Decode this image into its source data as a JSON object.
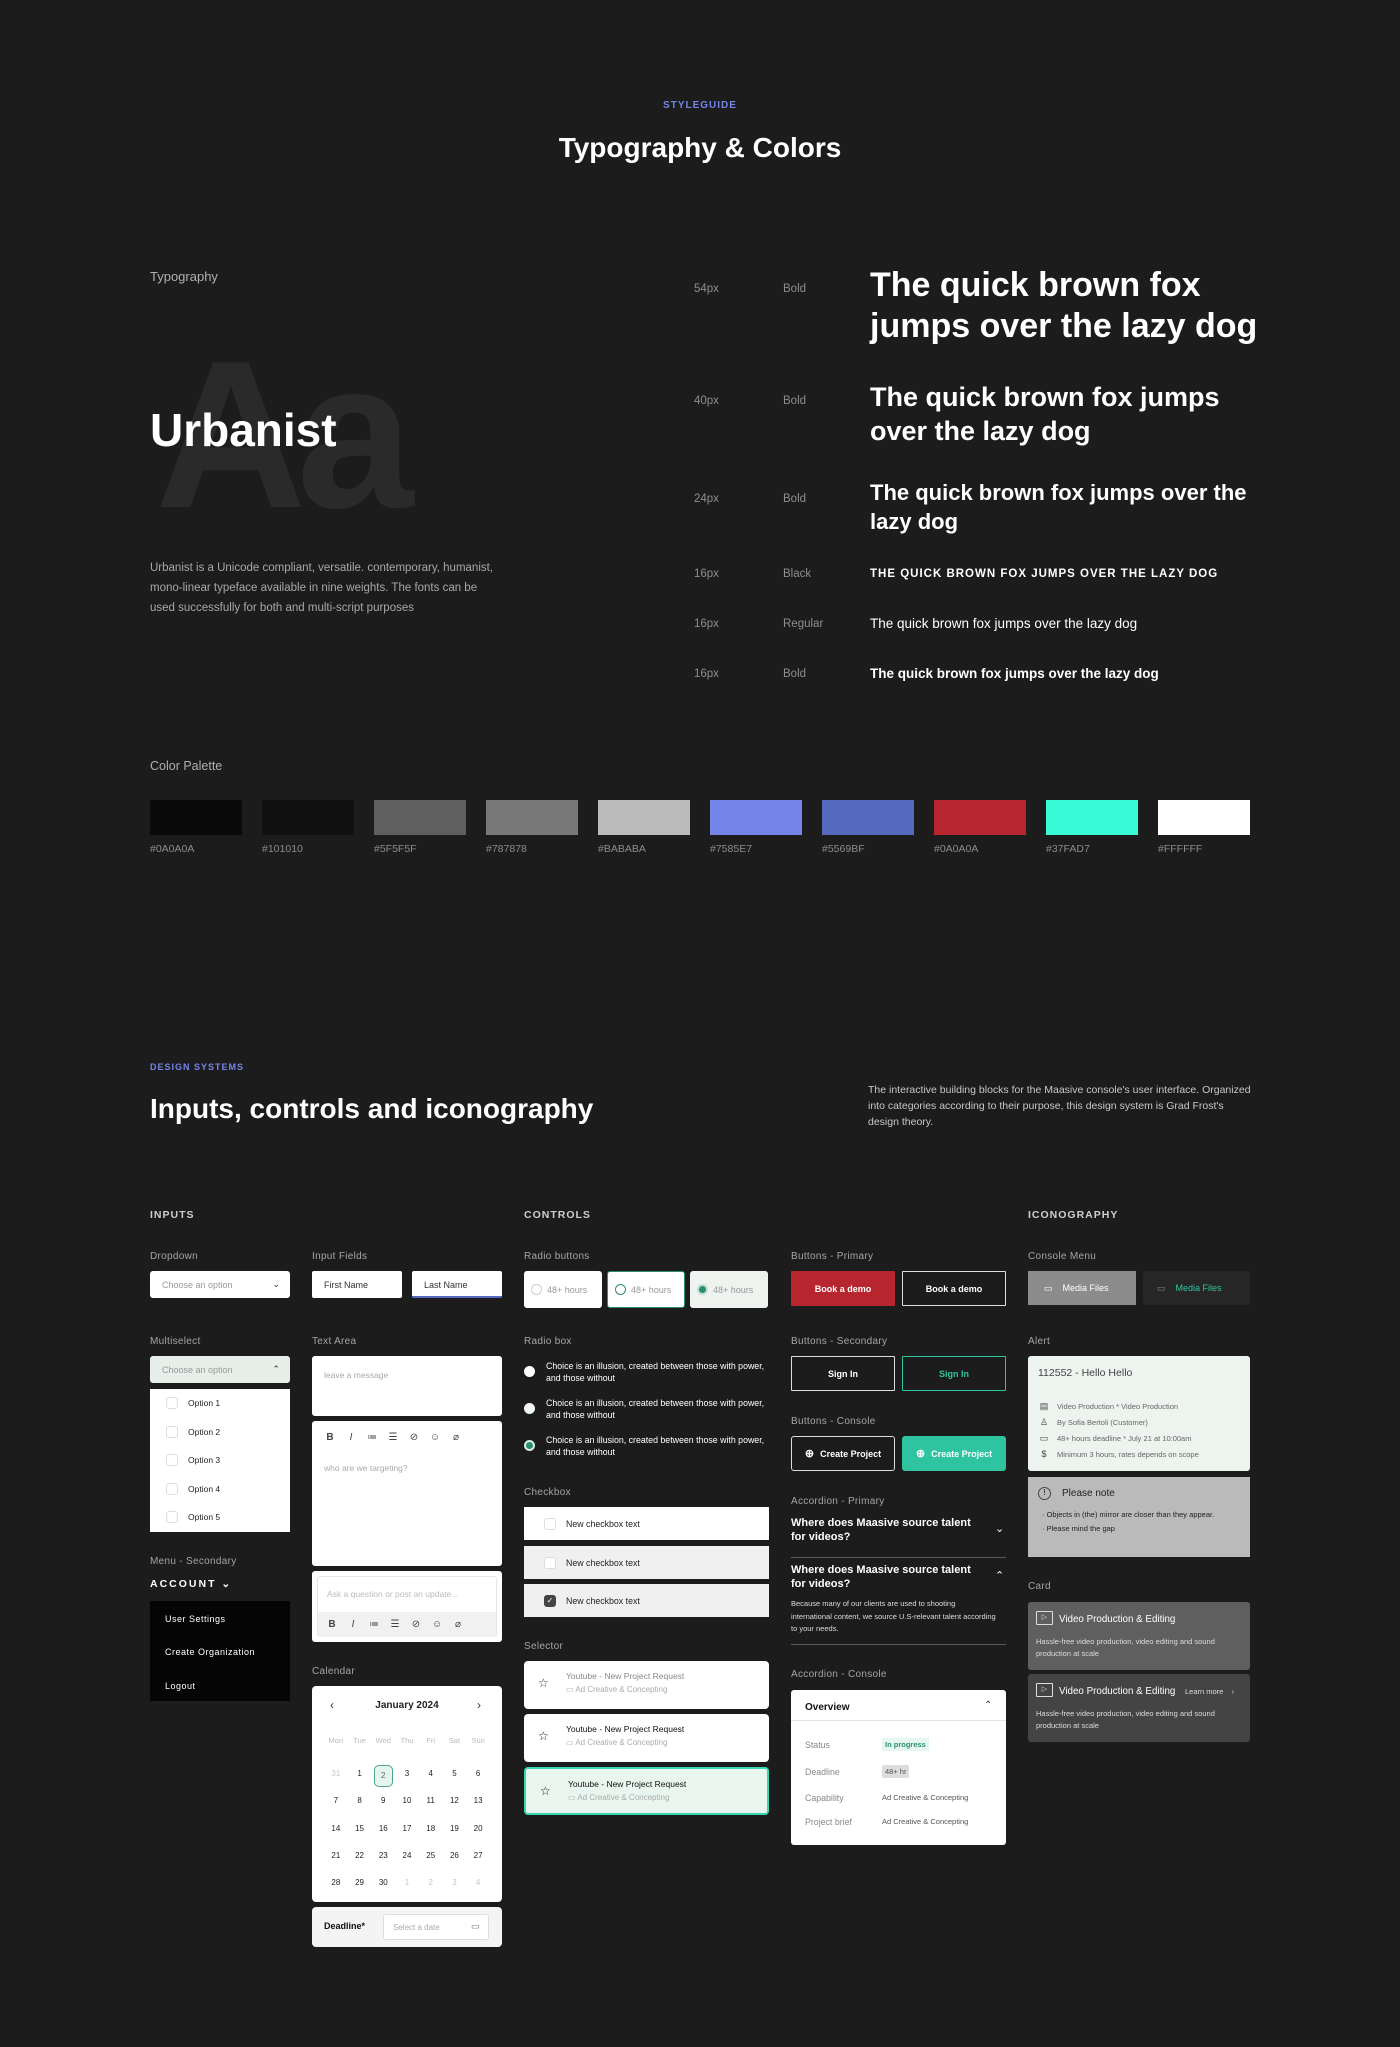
{
  "header": {
    "eyebrow": "STYLEGUIDE",
    "title": "Typography & Colors"
  },
  "typography": {
    "section_label": "Typography",
    "font_name": "Urbanist",
    "glyph_sample": "Aa",
    "description": "Urbanist is a Unicode compliant, versatile. contemporary, humanist, mono-linear typeface available in nine weights. The fonts can be used successfully for both and multi-script purposes",
    "samples": [
      {
        "size": "54px",
        "weight": "Bold",
        "text": "The quick brown fox jumps over the lazy dog"
      },
      {
        "size": "40px",
        "weight": "Bold",
        "text": "The quick brown fox jumps over the lazy dog"
      },
      {
        "size": "24px",
        "weight": "Bold",
        "text": "The quick brown fox jumps over the lazy dog"
      },
      {
        "size": "16px",
        "weight": "Black",
        "text": "THE QUICK BROWN FOX JUMPS OVER THE LAZY DOG"
      },
      {
        "size": "16px",
        "weight": "Regular",
        "text": "The quick brown fox jumps over the lazy dog"
      },
      {
        "size": "16px",
        "weight": "Bold",
        "text": "The quick brown fox jumps over the lazy dog"
      }
    ]
  },
  "palette": {
    "label": "Color Palette",
    "colors": [
      {
        "hex": "#0A0A0A",
        "label": "#0A0A0A"
      },
      {
        "hex": "#101010",
        "label": "#101010"
      },
      {
        "hex": "#5F5F5F",
        "label": "#5F5F5F"
      },
      {
        "hex": "#787878",
        "label": "#787878"
      },
      {
        "hex": "#BABABA",
        "label": "#BABABA"
      },
      {
        "hex": "#7585E7",
        "label": "#7585E7"
      },
      {
        "hex": "#5569BF",
        "label": "#5569BF"
      },
      {
        "hex": "#B7252F",
        "label": "#0A0A0A"
      },
      {
        "hex": "#37FAD7",
        "label": "#37FAD7"
      },
      {
        "hex": "#FFFFFF",
        "label": "#FFFFFF"
      }
    ]
  },
  "design_systems": {
    "eyebrow": "DESIGN SYSTEMS",
    "title": "Inputs, controls and iconography",
    "description": "The interactive building blocks for the Maasive console's user interface. Organized into categories according to their purpose, this design system is Grad Frost's design theory."
  },
  "inputs": {
    "heading": "INPUTS",
    "dropdown": {
      "label": "Dropdown",
      "placeholder": "Choose an option"
    },
    "input_fields": {
      "label": "Input Fields",
      "first_name": "First Name",
      "last_name": "Last Name"
    },
    "multiselect": {
      "label": "Multiselect",
      "placeholder": "Choose an option",
      "options": [
        "Option 1",
        "Option 2",
        "Option 3",
        "Option 4",
        "Option 5"
      ]
    },
    "text_area": {
      "label": "Text Area",
      "placeholder": "leave a message",
      "rich_placeholder": "who are we targeting?",
      "comment_placeholder": "Ask a question or post an update ..",
      "toolbar": [
        "B",
        "I",
        "≔",
        "☰",
        "🔗",
        "☺",
        "📎"
      ]
    },
    "menu_secondary": {
      "label": "Menu - Secondary",
      "trigger": "ACCOUNT",
      "items": [
        "User Settings",
        "Create Organization",
        "Logout"
      ]
    },
    "calendar": {
      "label": "Calendar",
      "month": "January 2024",
      "weekdays": [
        "Mon",
        "Tue",
        "Wed",
        "Thu",
        "Fri",
        "Sat",
        "Sun"
      ],
      "days": [
        {
          "d": "31",
          "muted": true
        },
        {
          "d": "1"
        },
        {
          "d": "2",
          "selected": true
        },
        {
          "d": "3"
        },
        {
          "d": "4"
        },
        {
          "d": "5"
        },
        {
          "d": "6"
        },
        {
          "d": "7"
        },
        {
          "d": "8"
        },
        {
          "d": "9"
        },
        {
          "d": "10"
        },
        {
          "d": "11"
        },
        {
          "d": "12"
        },
        {
          "d": "13"
        },
        {
          "d": "14"
        },
        {
          "d": "15"
        },
        {
          "d": "16"
        },
        {
          "d": "17"
        },
        {
          "d": "18"
        },
        {
          "d": "19"
        },
        {
          "d": "20"
        },
        {
          "d": "21"
        },
        {
          "d": "22"
        },
        {
          "d": "23"
        },
        {
          "d": "24"
        },
        {
          "d": "25"
        },
        {
          "d": "26"
        },
        {
          "d": "27"
        },
        {
          "d": "28"
        },
        {
          "d": "29"
        },
        {
          "d": "30"
        },
        {
          "d": "1",
          "muted": true
        },
        {
          "d": "2",
          "muted": true
        },
        {
          "d": "3",
          "muted": true
        },
        {
          "d": "4",
          "muted": true
        }
      ],
      "deadline_label": "Deadline*",
      "deadline_placeholder": "Select a date"
    }
  },
  "controls": {
    "heading": "CONTROLS",
    "radio_buttons": {
      "label": "Radio buttons",
      "option": "48+ hours"
    },
    "radio_box": {
      "label": "Radio box",
      "text": "Choice is an illusion, created between those with power, and those without"
    },
    "checkbox": {
      "label": "Checkbox",
      "text": "New checkbox text"
    },
    "selector": {
      "label": "Selector",
      "title": "Youtube - New Project Request",
      "subtitle": "Ad Creative & Concepting"
    },
    "buttons_primary": {
      "label": "Buttons - Primary",
      "text": "Book a demo"
    },
    "buttons_secondary": {
      "label": "Buttons - Secondary",
      "text": "Sign In"
    },
    "buttons_console": {
      "label": "Buttons - Console",
      "text": "Create Project"
    },
    "accordion_primary": {
      "label": "Accordion - Primary",
      "question": "Where does Maasive source talent for videos?",
      "answer": "Because many of our clients are used to shooting international content, we source U.S-relevant talent according to your needs."
    },
    "accordion_console": {
      "label": "Accordion - Console",
      "title": "Overview",
      "rows": [
        {
          "key": "Status",
          "value": "In progress"
        },
        {
          "key": "Deadline",
          "value": "48+ hr"
        },
        {
          "key": "Capability",
          "value": "Ad Creative & Concepting"
        },
        {
          "key": "Project brief",
          "value": "Ad Creative & Concepting"
        }
      ]
    }
  },
  "iconography": {
    "heading": "ICONOGRAPHY",
    "console_menu": {
      "label": "Console Menu",
      "item": "Media Files"
    },
    "alert": {
      "label": "Alert",
      "title": "112552 - Hello Hello",
      "lines": [
        "Video Production * Video Production",
        "By Sofia Bertoli (Customer)",
        "48+ hours deadline * July 21 at 10:00am",
        "Minimum 3 hours, rates depends on scope"
      ],
      "note_title": "Please note",
      "note_items": [
        "Objects in (the) mirror are closer than they appear.",
        "Please mind the gap"
      ]
    },
    "card": {
      "label": "Card",
      "title": "Video Production & Editing",
      "description": "Hassle-free video production, video editing and sound production at scale",
      "link": "Learn more"
    }
  },
  "colors": {
    "accent": "#7585E7",
    "green": "#2EC4A0",
    "red": "#B7252F"
  }
}
